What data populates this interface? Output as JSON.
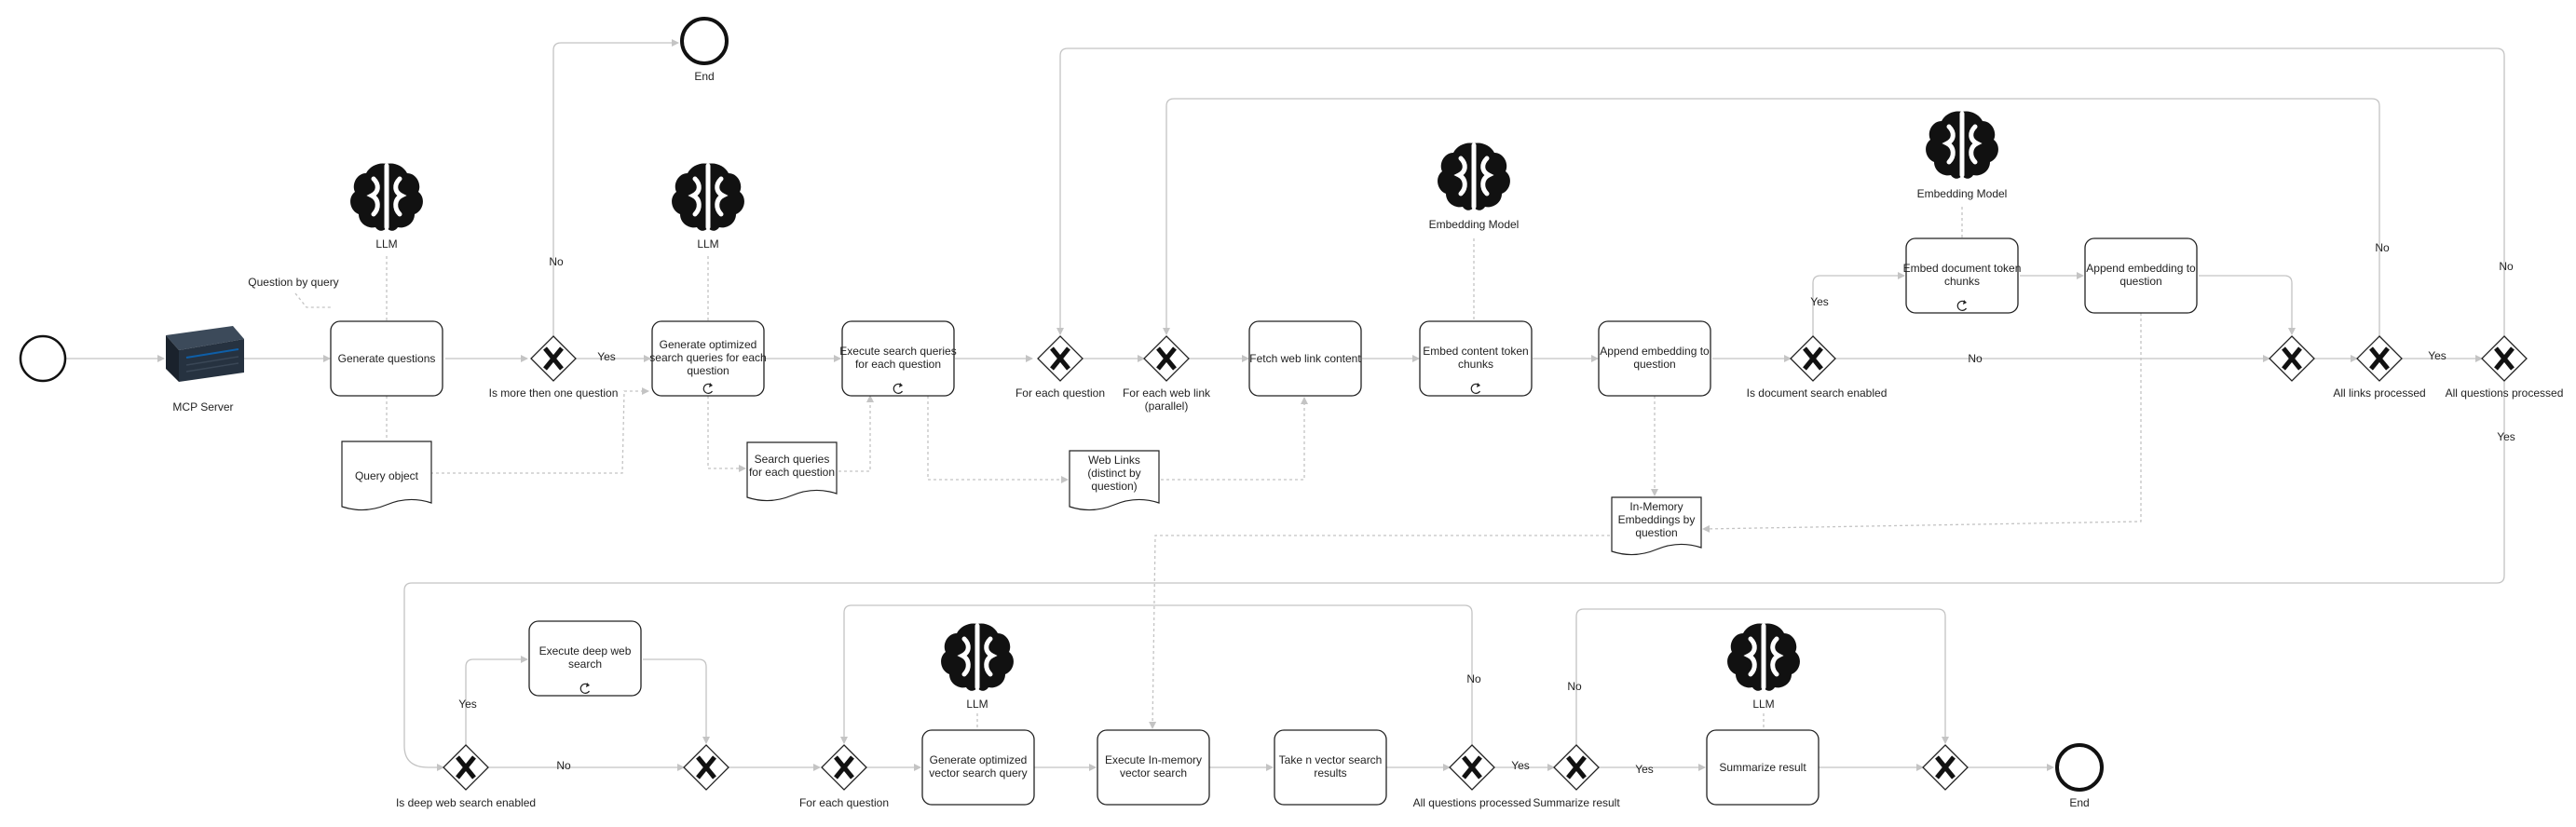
{
  "diagram": {
    "mcp_server_label": "MCP Server",
    "question_by_query": "Question by query",
    "tasks": {
      "generate_questions": [
        "Generate questions"
      ],
      "gen_optimized_queries": [
        "Generate optimized",
        "search queries for each",
        "question"
      ],
      "execute_search_queries": [
        "Execute search queries",
        "for each question"
      ],
      "fetch_web_link_content": [
        "Fetch web link content"
      ],
      "embed_content_chunks": [
        "Embed content token",
        "chunks"
      ],
      "append_embedding_1": [
        "Append embedding to",
        "question"
      ],
      "embed_document_chunks": [
        "Embed document token",
        "chunks"
      ],
      "append_embedding_2": [
        "Append embedding to",
        "question"
      ],
      "execute_deep_web_search": [
        "Execute deep web",
        "search"
      ],
      "gen_optimized_vector_query": [
        "Generate optimized",
        "vector search query"
      ],
      "execute_in_memory_search": [
        "Execute In-memory",
        "vector search"
      ],
      "take_n_results": [
        "Take n vector search",
        "results"
      ],
      "summarize_result": [
        "Summarize result"
      ]
    },
    "documents": {
      "query_object": [
        "Query object"
      ],
      "search_queries": [
        "Search queries",
        "for each question"
      ],
      "web_links": [
        "Web Links",
        "(distinct by",
        "question)"
      ],
      "in_memory_embeddings": [
        "In-Memory",
        "Embeddings by",
        "question"
      ]
    },
    "models": {
      "llm": "LLM",
      "embedding_model": "Embedding Model"
    },
    "gateways": {
      "more_than_one_question": [
        "Is more then one question"
      ],
      "for_each_question": [
        "For each question"
      ],
      "for_each_web_link": [
        "For each web link",
        "(parallel)"
      ],
      "doc_search_enabled": [
        "Is document search enabled"
      ],
      "all_links_processed": [
        "All links processed"
      ],
      "all_questions_processed": [
        "All questions processed"
      ],
      "deep_web_search_enabled": [
        "Is deep web search enabled"
      ],
      "for_each_question_2": [
        "For each question"
      ],
      "all_questions_processed_2": [
        "All questions processed"
      ],
      "summarize_result_gw": [
        "Summarize result"
      ]
    },
    "flow_labels": {
      "yes": "Yes",
      "no": "No"
    },
    "events": {
      "end": "End"
    }
  }
}
